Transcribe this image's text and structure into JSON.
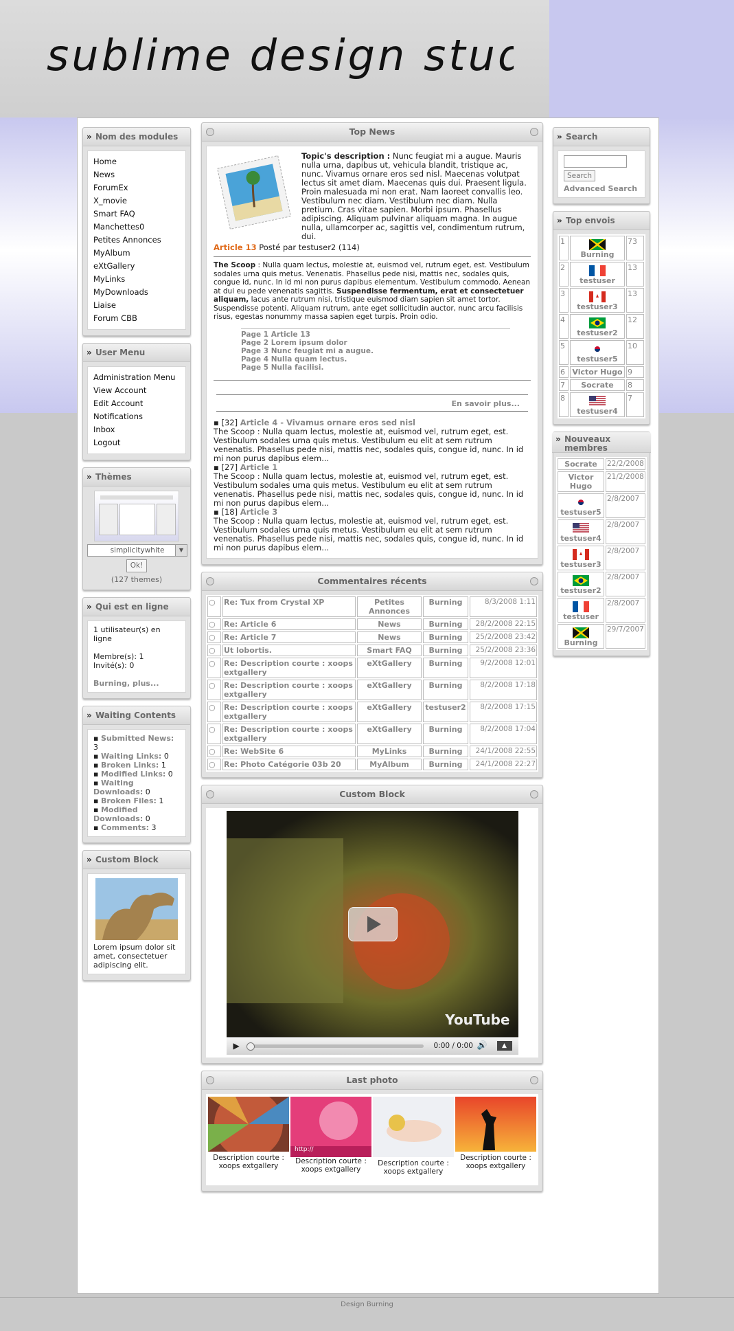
{
  "site": {
    "logo_text": "sublime design studios",
    "footer": "Design Burning"
  },
  "left": {
    "modules": {
      "title": "Nom des modules",
      "items": [
        "Home",
        "News",
        "ForumEx",
        "X_movie",
        "Smart FAQ",
        "Manchettes0",
        "Petites Annonces",
        "MyAlbum",
        "eXtGallery",
        "MyLinks",
        "MyDownloads",
        "Liaise",
        "Forum CBB"
      ]
    },
    "usermenu": {
      "title": "User Menu",
      "items": [
        "Administration Menu",
        "View Account",
        "Edit Account",
        "Notifications",
        "Inbox",
        "Logout"
      ]
    },
    "themes": {
      "title": "Thèmes",
      "selected": "simplicitywhite",
      "ok": "Ok!",
      "count": "(127 themes)"
    },
    "online": {
      "title": "Qui est en ligne",
      "line1": "1 utilisateur(s) en ligne",
      "members": "Membre(s): 1",
      "guests": "Invité(s): 0",
      "more": "Burning, plus..."
    },
    "waiting": {
      "title": "Waiting Contents",
      "items": [
        {
          "label": "Submitted News:",
          "val": "3"
        },
        {
          "label": "Waiting Links:",
          "val": "0"
        },
        {
          "label": "Broken Links:",
          "val": "1"
        },
        {
          "label": "Modified Links:",
          "val": "0"
        },
        {
          "label": "Waiting Downloads:",
          "val": "0"
        },
        {
          "label": "Broken Files:",
          "val": "1"
        },
        {
          "label": "Modified Downloads:",
          "val": "0"
        },
        {
          "label": "Comments:",
          "val": "3"
        }
      ]
    },
    "custom": {
      "title": "Custom Block",
      "text": "Lorem ipsum dolor sit amet, consectetuer adipiscing elit."
    }
  },
  "center": {
    "topnews": {
      "title": "Top News",
      "desc_label": "Topic's description :",
      "desc": "Nunc feugiat mi a augue. Mauris nulla urna, dapibus ut, vehicula blandit, tristique ac, nunc. Vivamus ornare eros sed nisl. Maecenas volutpat lectus sit amet diam. Maecenas quis dui. Praesent ligula. Proin malesuada mi non erat. Nam laoreet convallis leo. Vestibulum nec diam. Vestibulum nec diam. Nulla pretium. Cras vitae sapien. Morbi ipsum. Phasellus adipiscing. Aliquam pulvinar aliquam magna. In augue nulla, ullamcorper ac, sagittis vel, condimentum rutrum, dui.",
      "article_link": "Article 13",
      "posted": "Posté par testuser2 (114)",
      "scoop_label": "The Scoop",
      "scoop_text": ": Nulla quam lectus, molestie at, euismod vel, rutrum eget, est. Vestibulum sodales urna quis metus. Venenatis. Phasellus pede nisi, mattis nec, sodales quis, congue id, nunc. In id mi non purus dapibus elementum. Vestibulum commodo. Aenean at dui eu pede venenatis sagittis.",
      "scoop_bold": "Suspendisse fermentum, erat et consectetuer aliquam,",
      "scoop_end": "lacus ante rutrum nisi, tristique euismod diam sapien sit amet tortor. Suspendisse potenti. Aliquam rutrum, ante eget sollicitudin auctor, nunc arcu facilisis risus, egestas nonummy massa sapien eget turpis. Proin odio.",
      "pages": [
        "Page 1 Article 13",
        "Page 2 Lorem ipsum dolor",
        "Page 3 Nunc feugiat mi a augue.",
        "Page 4 Nulla quam lectus.",
        "Page 5 Nulla facilisi."
      ],
      "more": "En savoir plus...",
      "others": [
        {
          "num": "[32]",
          "title": "Article 4 - Vivamus ornare eros sed nisl",
          "text": "The Scoop : Nulla quam lectus, molestie at, euismod vel, rutrum eget, est. Vestibulum sodales urna quis metus. Vestibulum eu elit at sem rutrum venenatis. Phasellus pede nisi, mattis nec, sodales quis, congue id, nunc. In id mi non purus dapibus elem..."
        },
        {
          "num": "[27]",
          "title": "Article 1",
          "text": "The Scoop : Nulla quam lectus, molestie at, euismod vel, rutrum eget, est. Vestibulum sodales urna quis metus. Vestibulum eu elit at sem rutrum venenatis. Phasellus pede nisi, mattis nec, sodales quis, congue id, nunc. In id mi non purus dapibus elem..."
        },
        {
          "num": "[18]",
          "title": "Article 3",
          "text": "The Scoop : Nulla quam lectus, molestie at, euismod vel, rutrum eget, est. Vestibulum sodales urna quis metus. Vestibulum eu elit at sem rutrum venenatis. Phasellus pede nisi, mattis nec, sodales quis, congue id, nunc. In id mi non purus dapibus elem..."
        }
      ]
    },
    "comments": {
      "title": "Commentaires récents",
      "rows": [
        {
          "title": "Re: Tux from Crystal XP",
          "module": "Petites Annonces",
          "user": "Burning",
          "date": "8/3/2008 1:11"
        },
        {
          "title": "Re: Article 6",
          "module": "News",
          "user": "Burning",
          "date": "28/2/2008 22:15"
        },
        {
          "title": "Re: Article 7",
          "module": "News",
          "user": "Burning",
          "date": "25/2/2008 23:42"
        },
        {
          "title": "Ut lobortis.",
          "module": "Smart FAQ",
          "user": "Burning",
          "date": "25/2/2008 23:36"
        },
        {
          "title": "Re: Description courte : xoops extgallery",
          "module": "eXtGallery",
          "user": "Burning",
          "date": "9/2/2008 12:01"
        },
        {
          "title": "Re: Description courte : xoops extgallery",
          "module": "eXtGallery",
          "user": "Burning",
          "date": "8/2/2008 17:18"
        },
        {
          "title": "Re: Description courte : xoops extgallery",
          "module": "eXtGallery",
          "user": "testuser2",
          "date": "8/2/2008 17:15"
        },
        {
          "title": "Re: Description courte : xoops extgallery",
          "module": "eXtGallery",
          "user": "Burning",
          "date": "8/2/2008 17:04"
        },
        {
          "title": "Re: WebSite 6",
          "module": "MyLinks",
          "user": "Burning",
          "date": "24/1/2008 22:55"
        },
        {
          "title": "Re: Photo Catégorie 03b 20",
          "module": "MyAlbum",
          "user": "Burning",
          "date": "24/1/2008 22:27"
        }
      ]
    },
    "customblock": {
      "title": "Custom Block",
      "time": "0:00 / 0:00",
      "brand": "YouTube"
    },
    "lastphoto": {
      "title": "Last photo",
      "items": [
        "Description courte : xoops extgallery",
        "Description courte : xoops extgallery",
        "Description courte : xoops extgallery",
        "Description courte : xoops extgallery"
      ],
      "watermark": "http://"
    }
  },
  "right": {
    "search": {
      "title": "Search",
      "button": "Search",
      "advanced": "Advanced Search",
      "placeholder": ""
    },
    "top": {
      "title": "Top envois",
      "rows": [
        {
          "rank": "1",
          "name": "Burning",
          "count": "73",
          "flag": "jm"
        },
        {
          "rank": "2",
          "name": "testuser",
          "count": "13",
          "flag": "fr"
        },
        {
          "rank": "3",
          "name": "testuser3",
          "count": "13",
          "flag": "ca"
        },
        {
          "rank": "4",
          "name": "testuser2",
          "count": "12",
          "flag": "br"
        },
        {
          "rank": "5",
          "name": "testuser5",
          "count": "10",
          "flag": "kr"
        },
        {
          "rank": "6",
          "name": "Victor Hugo",
          "count": "9",
          "flag": ""
        },
        {
          "rank": "7",
          "name": "Socrate",
          "count": "8",
          "flag": ""
        },
        {
          "rank": "8",
          "name": "testuser4",
          "count": "7",
          "flag": "us"
        }
      ]
    },
    "newmembers": {
      "title": "Nouveaux membres",
      "rows": [
        {
          "name": "Socrate",
          "date": "22/2/2008",
          "flag": ""
        },
        {
          "name": "Victor Hugo",
          "date": "21/2/2008",
          "flag": ""
        },
        {
          "name": "testuser5",
          "date": "2/8/2007",
          "flag": "kr"
        },
        {
          "name": "testuser4",
          "date": "2/8/2007",
          "flag": "us"
        },
        {
          "name": "testuser3",
          "date": "2/8/2007",
          "flag": "ca"
        },
        {
          "name": "testuser2",
          "date": "2/8/2007",
          "flag": "br"
        },
        {
          "name": "testuser",
          "date": "2/8/2007",
          "flag": "fr"
        },
        {
          "name": "Burning",
          "date": "29/7/2007",
          "flag": "jm"
        }
      ]
    }
  }
}
